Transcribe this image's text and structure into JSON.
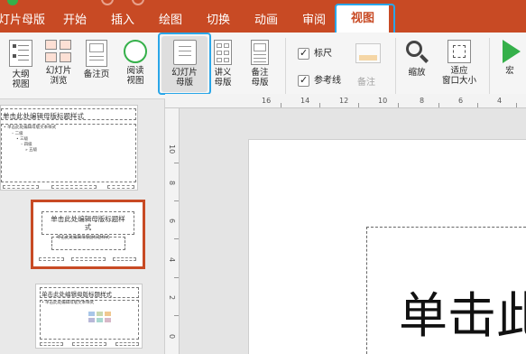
{
  "tabs": [
    {
      "label": "灯片母版",
      "active": false
    },
    {
      "label": "开始",
      "active": false
    },
    {
      "label": "插入",
      "active": false
    },
    {
      "label": "绘图",
      "active": false
    },
    {
      "label": "切换",
      "active": false
    },
    {
      "label": "动画",
      "active": false
    },
    {
      "label": "审阅",
      "active": false
    },
    {
      "label": "视图",
      "active": true
    }
  ],
  "ribbon": {
    "outline_view": "大纲\n视图",
    "slide_sorter": "幻灯片\n浏览",
    "notes_page": "备注页",
    "reading_view": "阅读\n视图",
    "slide_master": "幻灯片\n母版",
    "handout_master": "讲义\n母版",
    "notes_master": "备注\n母版",
    "ruler": "标尺",
    "guides": "参考线",
    "notes": "备注",
    "zoom": "缩放",
    "fit_to_window": "适应\n窗口大小",
    "macros": "宏"
  },
  "ruler_h_numbers": [
    "16",
    "14",
    "12",
    "10",
    "8",
    "6",
    "4",
    "2",
    "0",
    "2"
  ],
  "ruler_v_numbers": [
    "10",
    "8",
    "6",
    "4",
    "2",
    "0",
    "2"
  ],
  "thumbnails": {
    "master_title": "单击此处编辑母版标题样式",
    "master_body": [
      "• 单击此处编辑母版文本样式",
      "– 二级",
      "• 三级",
      "– 四级",
      "» 五级"
    ],
    "layout1_title": "单击此处编辑母版标题样\n式",
    "layout1_subtitle": "单击此处编辑母版副标题样式",
    "layout2_title": "单击此处编辑母版标题样式",
    "layout2_body": "• 单击此处编辑母版文本样式"
  },
  "canvas": {
    "title_text": "单击此"
  },
  "colors": {
    "accent": "#c84a24",
    "highlight": "#2aa6e8",
    "macro_green": "#35b04a"
  }
}
